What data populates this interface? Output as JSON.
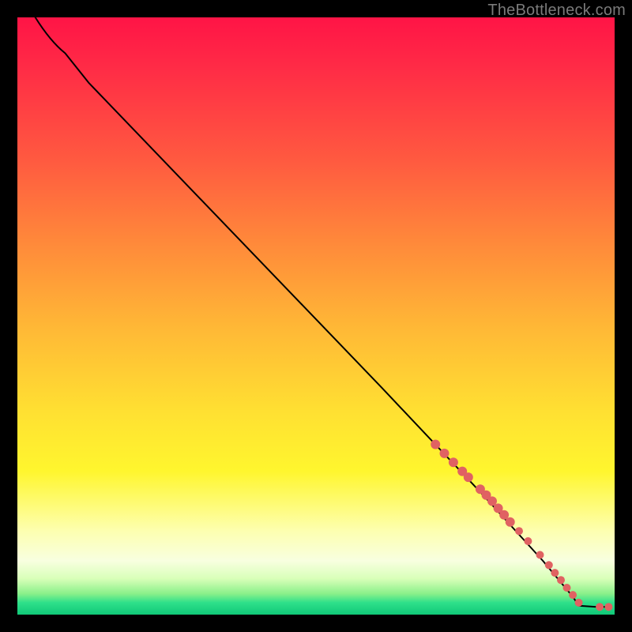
{
  "watermark": "TheBottleneck.com",
  "colors": {
    "marker": "#e06262",
    "curve": "#000000",
    "gradient_stops": [
      {
        "pos": 0,
        "hex": "#ff1446"
      },
      {
        "pos": 0.24,
        "hex": "#ff5a40"
      },
      {
        "pos": 0.52,
        "hex": "#ffb836"
      },
      {
        "pos": 0.76,
        "hex": "#fff62e"
      },
      {
        "pos": 0.94,
        "hex": "#d8ffb8"
      },
      {
        "pos": 1.0,
        "hex": "#10c878"
      }
    ]
  },
  "chart_data": {
    "type": "line",
    "title": "",
    "xlabel": "",
    "ylabel": "",
    "xlim": [
      0,
      100
    ],
    "ylim": [
      0,
      100
    ],
    "note": "x,y are normalized 0..100 within the colored plot area; y is descending from top. Curve runs from top-left to bottom-right; markers cluster on the lower-right segment.",
    "series": [
      {
        "name": "curve",
        "kind": "path",
        "points": [
          {
            "x": 3,
            "y": 0
          },
          {
            "x": 8,
            "y": 6
          },
          {
            "x": 12,
            "y": 11
          },
          {
            "x": 61,
            "y": 62
          },
          {
            "x": 78,
            "y": 80
          },
          {
            "x": 88,
            "y": 91
          },
          {
            "x": 93,
            "y": 97
          },
          {
            "x": 94,
            "y": 98.5
          },
          {
            "x": 97,
            "y": 98.7
          },
          {
            "x": 99,
            "y": 98.7
          }
        ]
      },
      {
        "name": "markers",
        "kind": "scatter",
        "points": [
          {
            "x": 70.0,
            "y": 71.5,
            "r": 6
          },
          {
            "x": 71.5,
            "y": 73.0,
            "r": 6
          },
          {
            "x": 73.0,
            "y": 74.5,
            "r": 6
          },
          {
            "x": 74.5,
            "y": 76.0,
            "r": 6
          },
          {
            "x": 75.5,
            "y": 77.0,
            "r": 6
          },
          {
            "x": 77.5,
            "y": 79.0,
            "r": 6
          },
          {
            "x": 78.5,
            "y": 80.0,
            "r": 6
          },
          {
            "x": 79.5,
            "y": 81.0,
            "r": 6
          },
          {
            "x": 80.5,
            "y": 82.2,
            "r": 6
          },
          {
            "x": 81.5,
            "y": 83.3,
            "r": 6
          },
          {
            "x": 82.5,
            "y": 84.5,
            "r": 6
          },
          {
            "x": 84.0,
            "y": 86.0,
            "r": 5
          },
          {
            "x": 85.5,
            "y": 87.7,
            "r": 5
          },
          {
            "x": 87.5,
            "y": 90.0,
            "r": 5
          },
          {
            "x": 89.0,
            "y": 91.7,
            "r": 5
          },
          {
            "x": 90.0,
            "y": 93.0,
            "r": 5
          },
          {
            "x": 91.0,
            "y": 94.2,
            "r": 5
          },
          {
            "x": 92.0,
            "y": 95.5,
            "r": 5
          },
          {
            "x": 93.0,
            "y": 96.7,
            "r": 5
          },
          {
            "x": 94.0,
            "y": 98.0,
            "r": 5
          },
          {
            "x": 97.5,
            "y": 98.7,
            "r": 5
          },
          {
            "x": 99.0,
            "y": 98.7,
            "r": 5
          }
        ]
      }
    ]
  }
}
